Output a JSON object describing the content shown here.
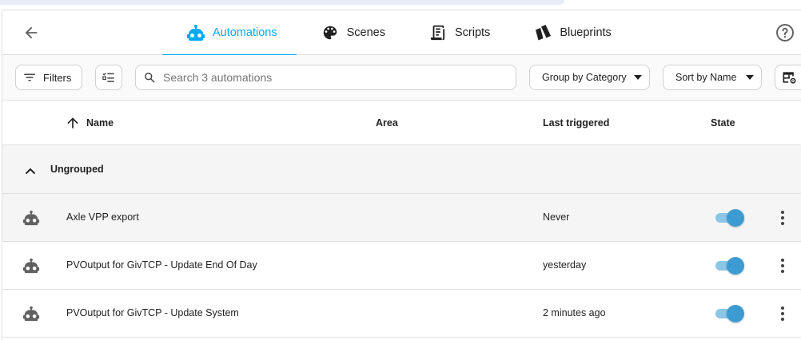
{
  "header": {
    "tabs": [
      {
        "label": "Automations",
        "icon": "robot-icon",
        "active": true
      },
      {
        "label": "Scenes",
        "icon": "palette-icon",
        "active": false
      },
      {
        "label": "Scripts",
        "icon": "script-icon",
        "active": false
      },
      {
        "label": "Blueprints",
        "icon": "blueprint-icon",
        "active": false
      }
    ]
  },
  "toolbar": {
    "filters_label": "Filters",
    "search_placeholder": "Search 3 automations",
    "search_value": "",
    "group_by_label": "Group by Category",
    "sort_by_label": "Sort by Name"
  },
  "table": {
    "columns": {
      "name": "Name",
      "area": "Area",
      "last_triggered": "Last triggered",
      "state": "State"
    },
    "group_label": "Ungrouped",
    "rows": [
      {
        "name": "Axle VPP export",
        "area": "",
        "last_triggered": "Never",
        "enabled": true
      },
      {
        "name": "PVOutput for GivTCP - Update End Of Day",
        "area": "",
        "last_triggered": "yesterday",
        "enabled": true
      },
      {
        "name": "PVOutput for GivTCP - Update System",
        "area": "",
        "last_triggered": "2 minutes ago",
        "enabled": true
      }
    ]
  },
  "colors": {
    "accent": "#03a9f4",
    "toggle_knob": "#3d9bd2",
    "toggle_track": "#8bc6e6"
  }
}
